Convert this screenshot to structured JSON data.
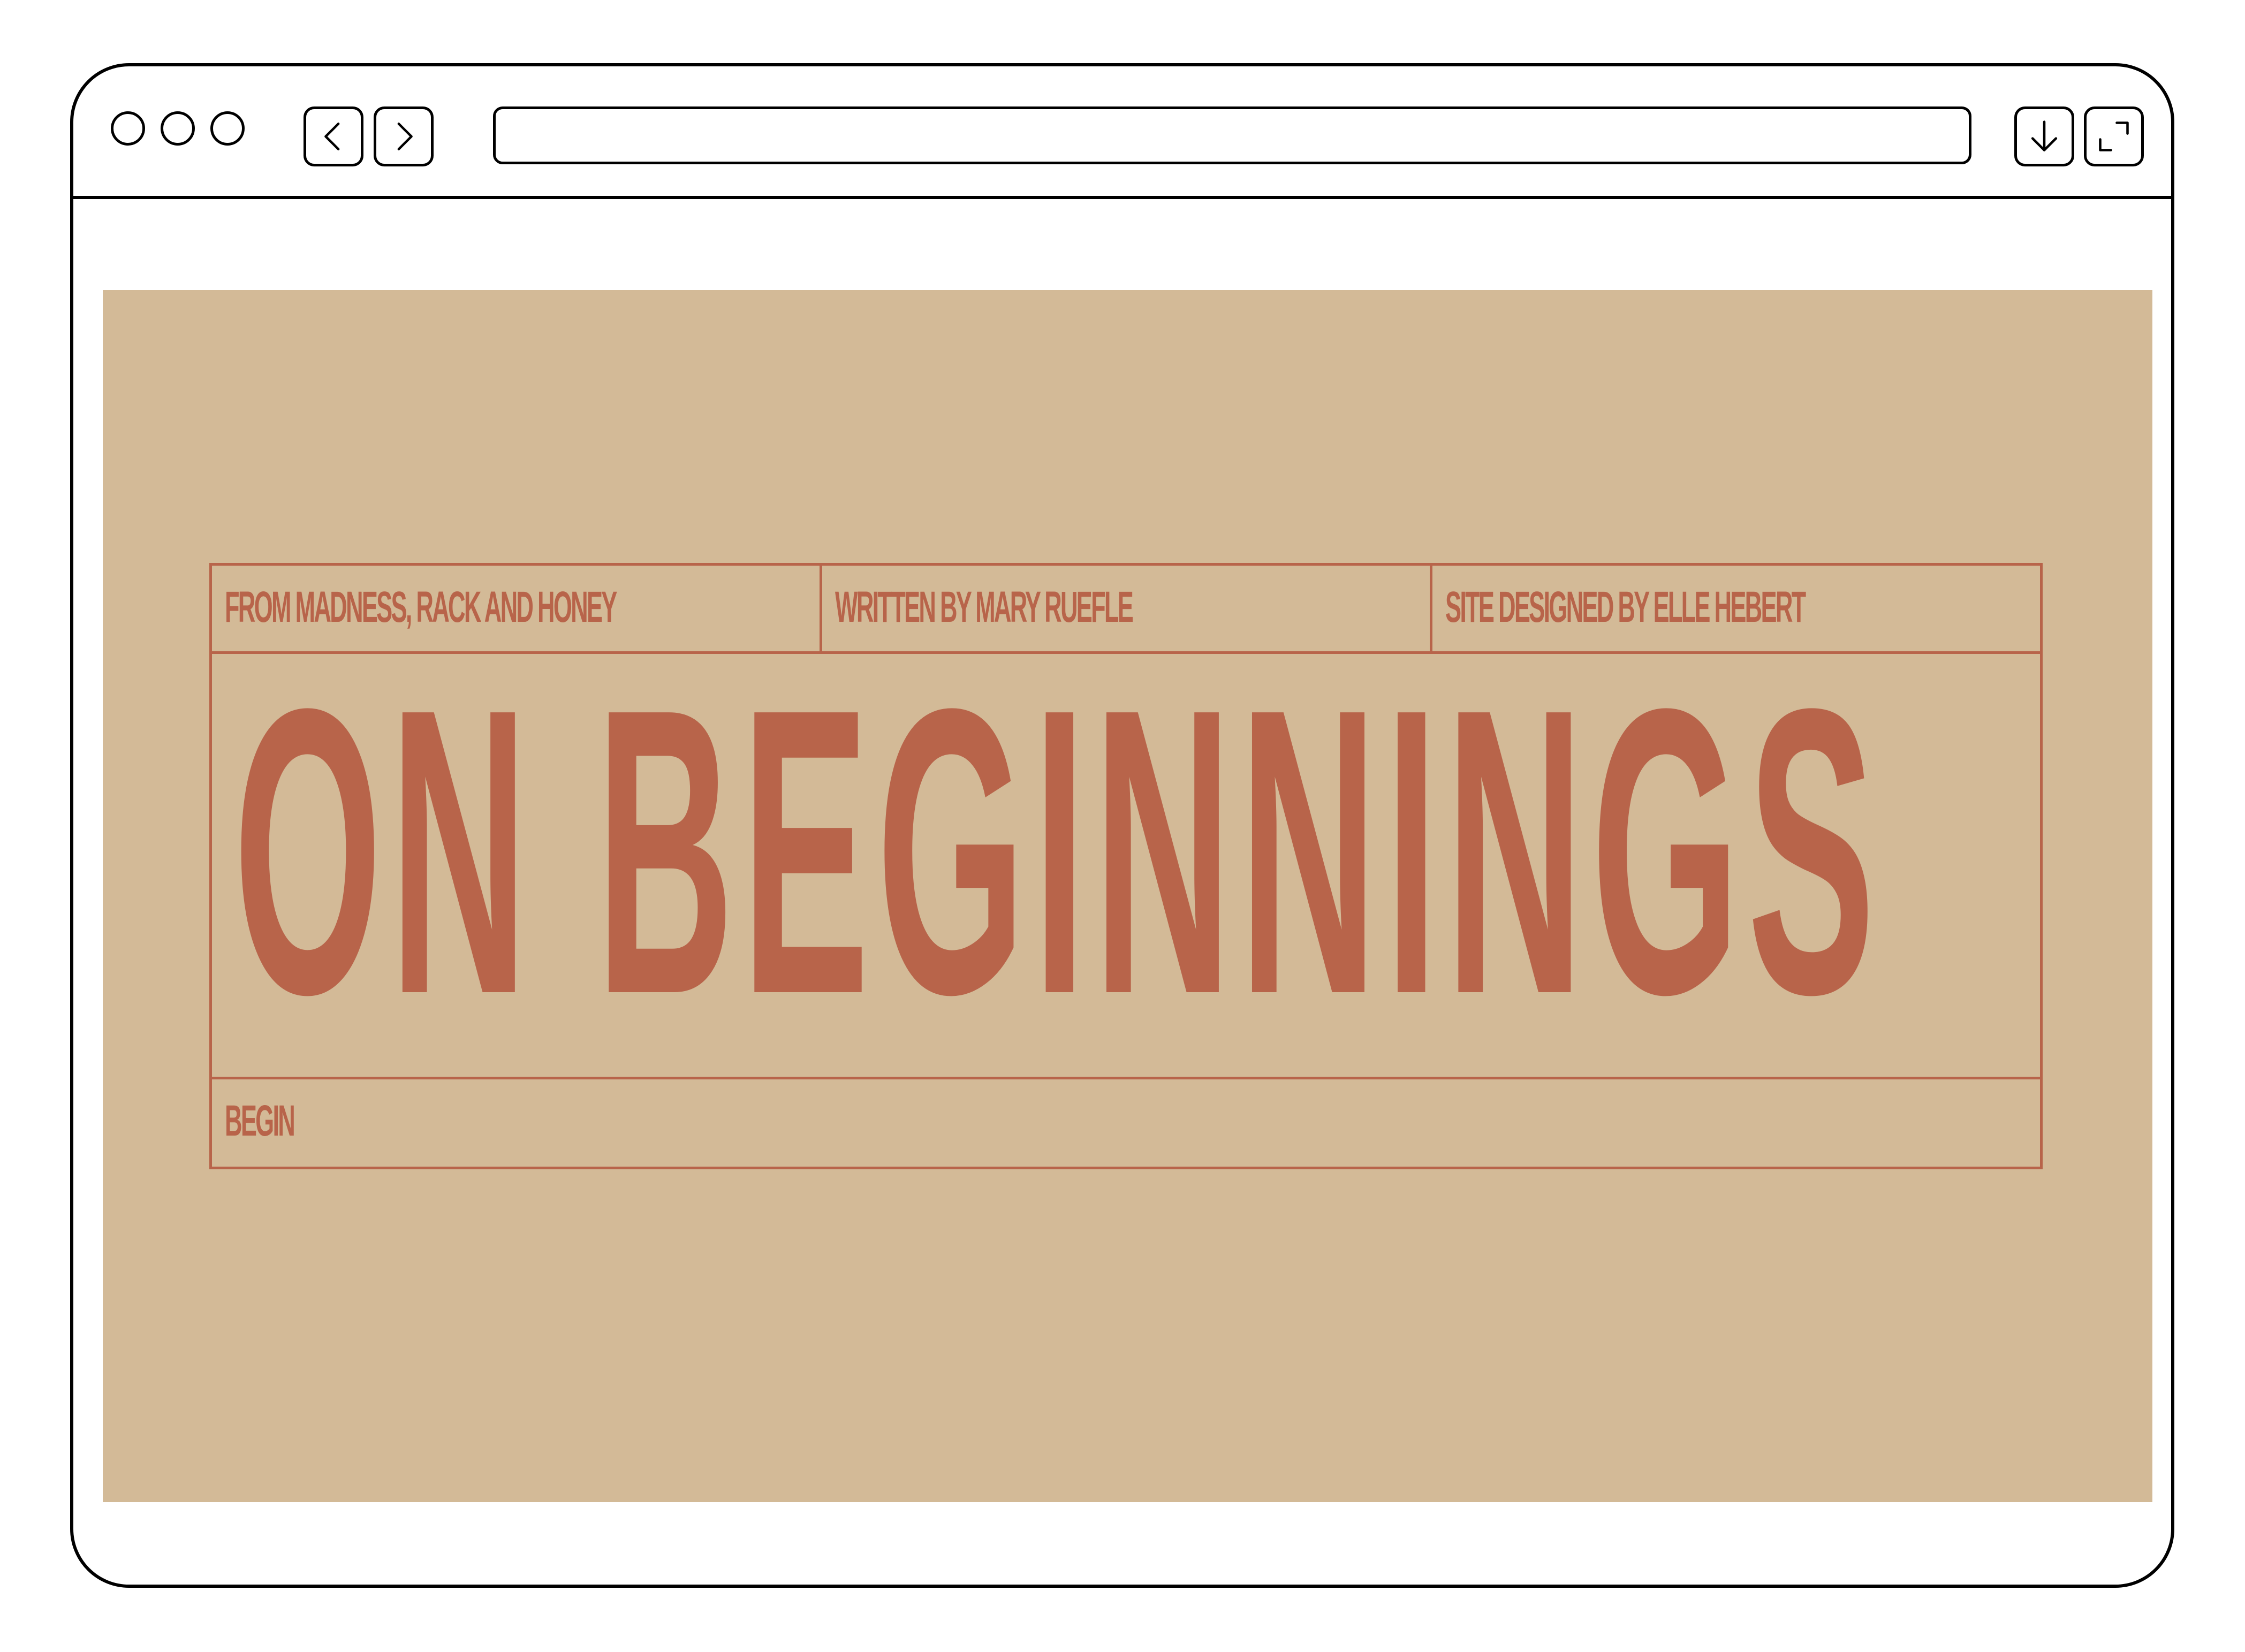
{
  "browser": {
    "url": "",
    "window_controls": [
      "window-dot-icon",
      "window-dot-icon",
      "window-dot-icon"
    ],
    "nav_icons": [
      "chevron-left-icon",
      "chevron-right-icon"
    ],
    "tool_icons": [
      "download-icon",
      "expand-icon"
    ]
  },
  "page": {
    "colors": {
      "background": "#d3ba97",
      "accent": "#b8644a"
    },
    "credits": [
      "FROM MADNESS, RACK AND HONEY",
      "WRITTEN BY MARY RUEFLE",
      "SITE DESIGNED BY ELLE HEBERT"
    ],
    "title": "ON BEGINNINGS",
    "begin_link": "BEGIN"
  }
}
